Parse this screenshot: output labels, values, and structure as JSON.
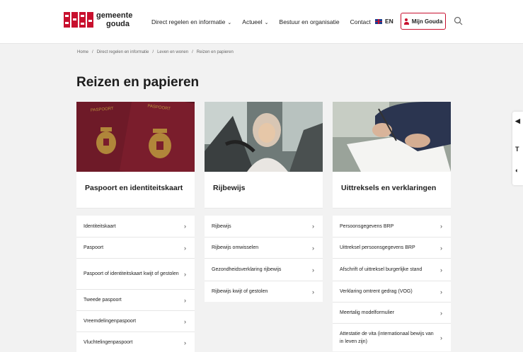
{
  "header": {
    "logo_line1": "gemeente",
    "logo_line2": "gouda",
    "nav": [
      {
        "label": "Direct regelen en informatie",
        "has_dropdown": true
      },
      {
        "label": "Actueel",
        "has_dropdown": true
      },
      {
        "label": "Bestuur en organisatie",
        "has_dropdown": false
      },
      {
        "label": "Contact",
        "has_dropdown": false
      }
    ],
    "lang_label": "EN",
    "mijn_label": "Mijn Gouda",
    "accent_color": "#c8102e"
  },
  "breadcrumb": [
    "Home",
    "/",
    "Direct regelen en informatie",
    "/",
    "Leven en wonen",
    "/",
    "Reizen en papieren"
  ],
  "page_title": "Reizen en papieren",
  "cards": [
    {
      "title": "Paspoort en identiteitskaart",
      "image": "passports-photo",
      "links": [
        "Identiteitskaart",
        "Paspoort",
        "Paspoort of identiteitskaart kwijt of gestolen",
        "Tweede paspoort",
        "Vreemdelingenpaspoort",
        "Vluchtelingenpaspoort"
      ]
    },
    {
      "title": "Rijbewijs",
      "image": "driver-in-car-photo",
      "links": [
        "Rijbewijs",
        "Rijbewijs omwisselen",
        "Gezondheidsverklaring rijbewijs",
        "Rijbewijs kwijt of gestolen"
      ]
    },
    {
      "title": "Uittreksels en verklaringen",
      "image": "signing-document-photo",
      "links": [
        "Persoonsgegevens BRP",
        "Uittreksel persoonsgegevens BRP",
        "Afschrift of uittreksel burgerlijke stand",
        "Verklaring omtrent gedrag (VOG)",
        "Meertalig modelformulier",
        "Attestatie de vita (internationaal bewijs van in leven zijn)"
      ]
    }
  ],
  "side_widget": {
    "items": [
      "◀",
      "T",
      "◐"
    ]
  }
}
